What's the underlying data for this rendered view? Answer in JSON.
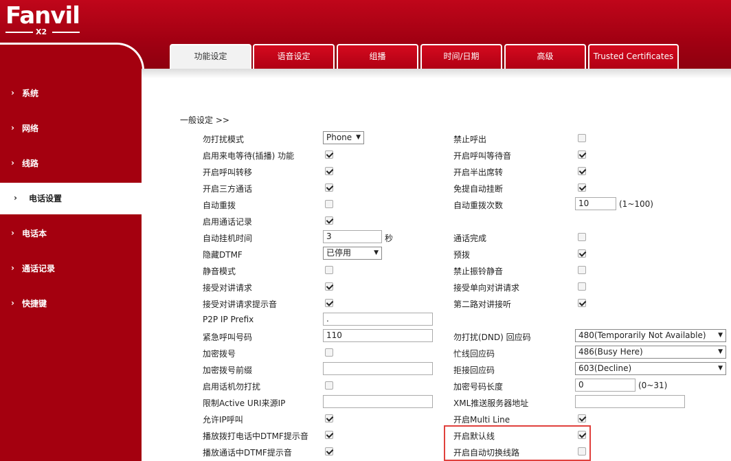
{
  "brand": {
    "name": "Fanvil",
    "model": "X2"
  },
  "sidebar": {
    "items": [
      {
        "label": "系统"
      },
      {
        "label": "网络"
      },
      {
        "label": "线路"
      },
      {
        "label": "电话设置",
        "active": true
      },
      {
        "label": "电话本"
      },
      {
        "label": "通话记录"
      },
      {
        "label": "快捷键"
      }
    ]
  },
  "tabs": [
    {
      "label": "功能设定",
      "active": true
    },
    {
      "label": "语音设定"
    },
    {
      "label": "组播"
    },
    {
      "label": "时间/日期"
    },
    {
      "label": "高级"
    },
    {
      "label": "Trusted Certificates"
    }
  ],
  "section": {
    "title": "一般设定 >>"
  },
  "left_fields": [
    {
      "label": "勿打扰模式",
      "type": "select",
      "value": "Phone"
    },
    {
      "label": "启用来电等待(插播) 功能",
      "type": "checkbox",
      "checked": true
    },
    {
      "label": "开启呼叫转移",
      "type": "checkbox",
      "checked": true
    },
    {
      "label": "开启三方通话",
      "type": "checkbox",
      "checked": true
    },
    {
      "label": "自动重拨",
      "type": "checkbox",
      "checked": false
    },
    {
      "label": "启用通话记录",
      "type": "checkbox",
      "checked": true
    },
    {
      "label": "自动挂机时间",
      "type": "text",
      "value": "3",
      "unit": "秒"
    },
    {
      "label": "隐藏DTMF",
      "type": "select",
      "value": "已停用"
    },
    {
      "label": "静音模式",
      "type": "checkbox",
      "checked": false
    },
    {
      "label": "接受对讲请求",
      "type": "checkbox",
      "checked": true
    },
    {
      "label": "接受对讲请求提示音",
      "type": "checkbox",
      "checked": true
    },
    {
      "label": "P2P IP Prefix",
      "type": "text",
      "value": "."
    },
    {
      "label": "紧急呼叫号码",
      "type": "text",
      "value": "110"
    },
    {
      "label": "加密拨号",
      "type": "checkbox",
      "checked": false
    },
    {
      "label": "加密拨号前缀",
      "type": "text",
      "value": ""
    },
    {
      "label": "启用话机勿打扰",
      "type": "checkbox",
      "checked": false
    },
    {
      "label": "限制Active URI来源IP",
      "type": "text",
      "value": ""
    },
    {
      "label": "允许IP呼叫",
      "type": "checkbox",
      "checked": true
    },
    {
      "label": "播放拨打电话中DTMF提示音",
      "type": "checkbox",
      "checked": true
    },
    {
      "label": "播放通话中DTMF提示音",
      "type": "checkbox",
      "checked": true
    }
  ],
  "right_fields": [
    {
      "label": "禁止呼出",
      "type": "checkbox",
      "checked": false
    },
    {
      "label": "开启呼叫等待音",
      "type": "checkbox",
      "checked": true
    },
    {
      "label": "开启半出席转",
      "type": "checkbox",
      "checked": true
    },
    {
      "label": "免提自动挂断",
      "type": "checkbox",
      "checked": true
    },
    {
      "label": "自动重拨次数",
      "type": "text",
      "value": "10",
      "unit": "(1~100)"
    },
    {
      "label": "",
      "type": "none"
    },
    {
      "label": "通话完成",
      "type": "checkbox",
      "checked": false
    },
    {
      "label": "预拨",
      "type": "checkbox",
      "checked": true
    },
    {
      "label": "禁止振铃静音",
      "type": "checkbox",
      "checked": false
    },
    {
      "label": "接受单向对讲请求",
      "type": "checkbox",
      "checked": false
    },
    {
      "label": "第二路对讲接听",
      "type": "checkbox",
      "checked": true
    },
    {
      "label": "",
      "type": "none"
    },
    {
      "label": "勿打扰(DND) 回应码",
      "type": "select",
      "value": "480(Temporarily Not Available)"
    },
    {
      "label": "忙线回应码",
      "type": "select",
      "value": "486(Busy Here)"
    },
    {
      "label": "拒接回应码",
      "type": "select",
      "value": "603(Decline)"
    },
    {
      "label": "加密号码长度",
      "type": "text",
      "value": "0",
      "unit": "(0~31)"
    },
    {
      "label": "XML推送服务器地址",
      "type": "text",
      "value": ""
    },
    {
      "label": "开启Multi Line",
      "type": "checkbox",
      "checked": true
    },
    {
      "label": "开启默认线",
      "type": "checkbox",
      "checked": true
    },
    {
      "label": "开启自动切换线路",
      "type": "checkbox",
      "checked": false
    }
  ],
  "colors": {
    "brand_red": "#a4000f",
    "highlight_red": "#e0403c"
  },
  "icons": {
    "chevron": "chevron-right-icon",
    "dropdown": "dropdown-arrow-icon"
  }
}
